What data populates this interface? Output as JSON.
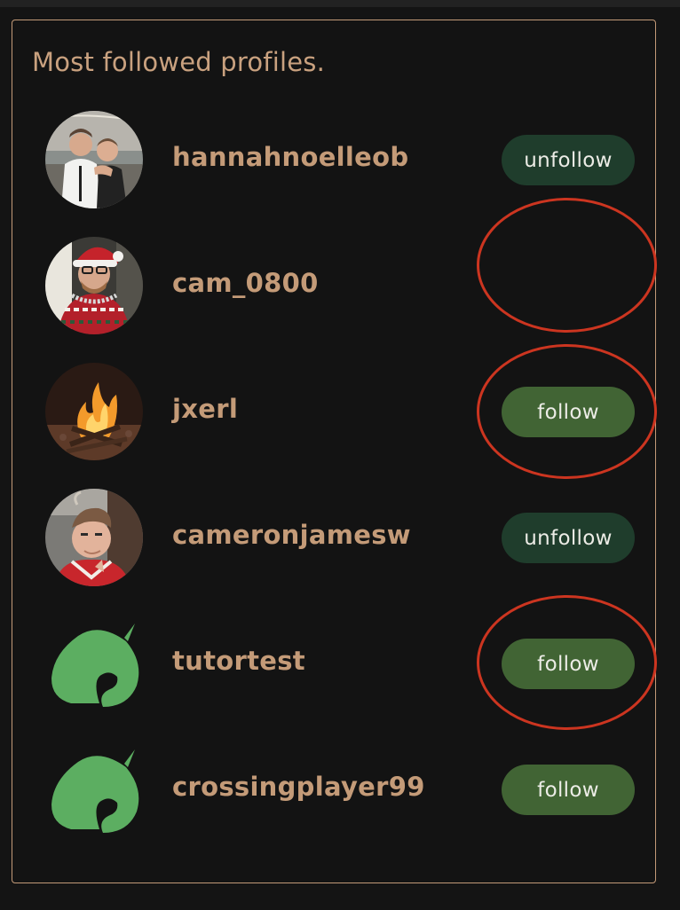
{
  "panel": {
    "title": "Most followed profiles."
  },
  "profiles": [
    {
      "username": "hannahnoelleob",
      "avatar": "photo-couple",
      "button_label": "unfollow",
      "button_state": "unfollow"
    },
    {
      "username": "cam_0800",
      "avatar": "photo-santa-hat",
      "button_label": "",
      "button_state": "none"
    },
    {
      "username": "jxerl",
      "avatar": "photo-bonfire",
      "button_label": "follow",
      "button_state": "follow"
    },
    {
      "username": "cameronjamesw",
      "avatar": "photo-man-red",
      "button_label": "unfollow",
      "button_state": "unfollow"
    },
    {
      "username": "tutortest",
      "avatar": "leaf-icon",
      "button_label": "follow",
      "button_state": "follow"
    },
    {
      "username": "crossingplayer99",
      "avatar": "leaf-icon",
      "button_label": "follow",
      "button_state": "follow"
    }
  ],
  "colors": {
    "background": "#141414",
    "border": "#c39a78",
    "text_accent": "#c49b78",
    "unfollow_button": "#1f3d2c",
    "follow_button": "#416434",
    "leaf": "#5cae61",
    "annotation_circle": "#cc3520"
  }
}
